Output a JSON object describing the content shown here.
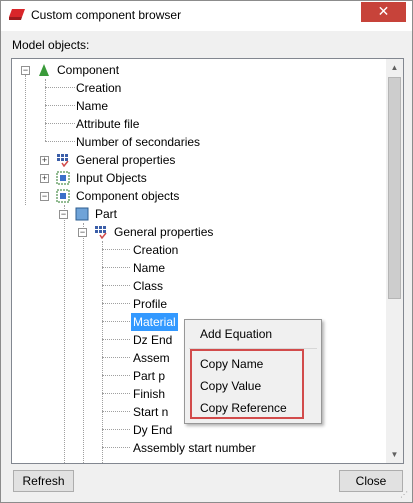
{
  "window": {
    "title": "Custom component browser",
    "close_glyph": "✕"
  },
  "model_objects_label": "Model objects:",
  "tree": {
    "component": "Component",
    "component_children": [
      "Creation",
      "Name",
      "Attribute file",
      "Number of secondaries"
    ],
    "general_properties": "General properties",
    "input_objects": "Input Objects",
    "component_objects": "Component objects",
    "part": "Part",
    "part_general_properties": "General properties",
    "part_props": [
      "Creation",
      "Name",
      "Class",
      "Profile",
      "Material",
      "Dz End",
      "Assem",
      "Part p",
      "Finish",
      "Start n",
      "Dy End",
      "Assembly start number"
    ]
  },
  "context_menu": {
    "add_equation": "Add Equation",
    "copy_name": "Copy Name",
    "copy_value": "Copy Value",
    "copy_reference": "Copy Reference"
  },
  "buttons": {
    "refresh": "Refresh",
    "close": "Close"
  },
  "colors": {
    "accent_red": "#d24b4b",
    "selection": "#3399ff"
  }
}
